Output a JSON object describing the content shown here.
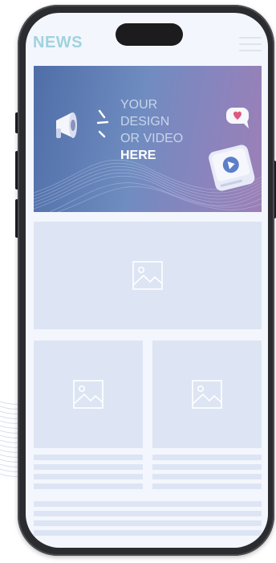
{
  "header": {
    "title": "NEWS"
  },
  "hero": {
    "lines": [
      "YOUR",
      "DESIGN",
      "OR VIDEO"
    ],
    "emphasis": "HERE"
  },
  "icons": {
    "menu": "hamburger-menu-icon",
    "megaphone": "megaphone-icon",
    "heart": "heart-chat-bubble-icon",
    "video": "video-play-card-icon",
    "image": "image-placeholder-icon"
  },
  "colors": {
    "title": "#9fd3de",
    "hero_start": "#4f6ea8",
    "hero_end": "#9d7fb6",
    "placeholder": "#dde5f4",
    "screen_bg": "#f3f6fc",
    "frame": "#2b2c30"
  }
}
